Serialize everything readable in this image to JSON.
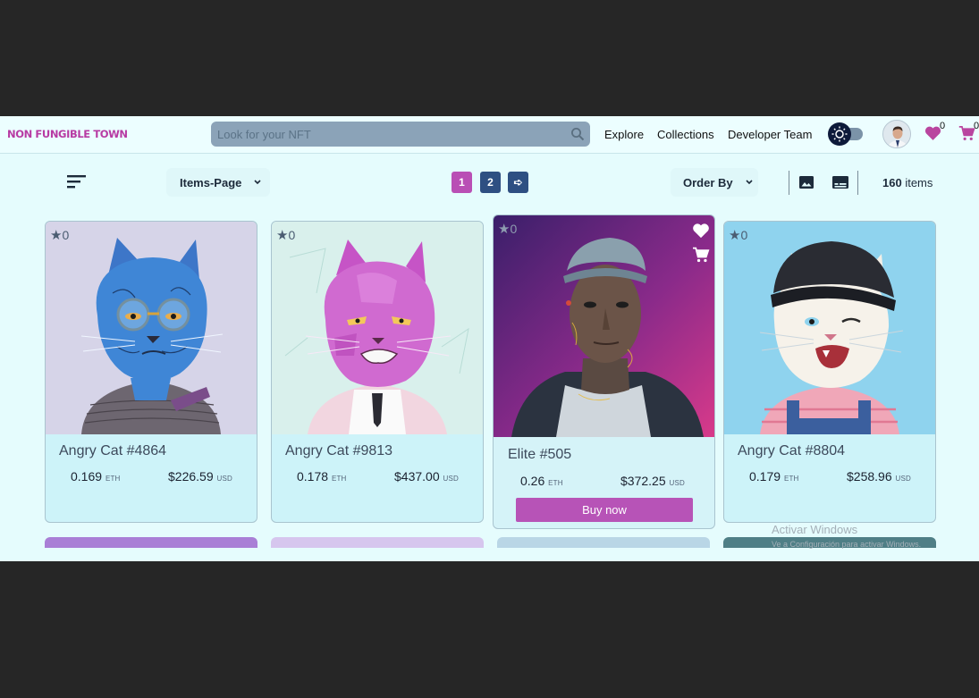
{
  "app": {
    "logo": "NON FUNGIBLE TOWN"
  },
  "search": {
    "placeholder": "Look for your NFT",
    "value": ""
  },
  "nav": {
    "explore": "Explore",
    "collections": "Collections",
    "developer_team": "Developer Team"
  },
  "header_badges": {
    "favorites_count": "0",
    "cart_count": "0"
  },
  "toolbar": {
    "items_page_label": "Items-Page",
    "pages": [
      "1",
      "2"
    ],
    "current_page": "1",
    "next_label": "➪",
    "order_by_label": "Order By",
    "items_count": "160",
    "items_suffix": "items"
  },
  "cards": [
    {
      "title": "Angry Cat #4864",
      "favorites": "0",
      "eth": "0.169",
      "eth_unit": "ETH",
      "usd": "$226.59",
      "usd_unit": "USD"
    },
    {
      "title": "Angry Cat #9813",
      "favorites": "0",
      "eth": "0.178",
      "eth_unit": "ETH",
      "usd": "$437.00",
      "usd_unit": "USD"
    },
    {
      "title": "Elite #505",
      "favorites": "0",
      "eth": "0.26",
      "eth_unit": "ETH",
      "usd": "$372.25",
      "usd_unit": "USD",
      "buy_label": "Buy now"
    },
    {
      "title": "Angry Cat #8804",
      "favorites": "0",
      "eth": "0.179",
      "eth_unit": "ETH",
      "usd": "$258.96",
      "usd_unit": "USD"
    }
  ],
  "overlay": {
    "activate_title": "Activar Windows",
    "activate_sub": "Ve a Configuración para activar Windows."
  },
  "colors": {
    "accent": "#b94fb5",
    "navy": "#2e4f82",
    "page_bg": "#e5fcfd",
    "logo": "#b73aa3"
  }
}
